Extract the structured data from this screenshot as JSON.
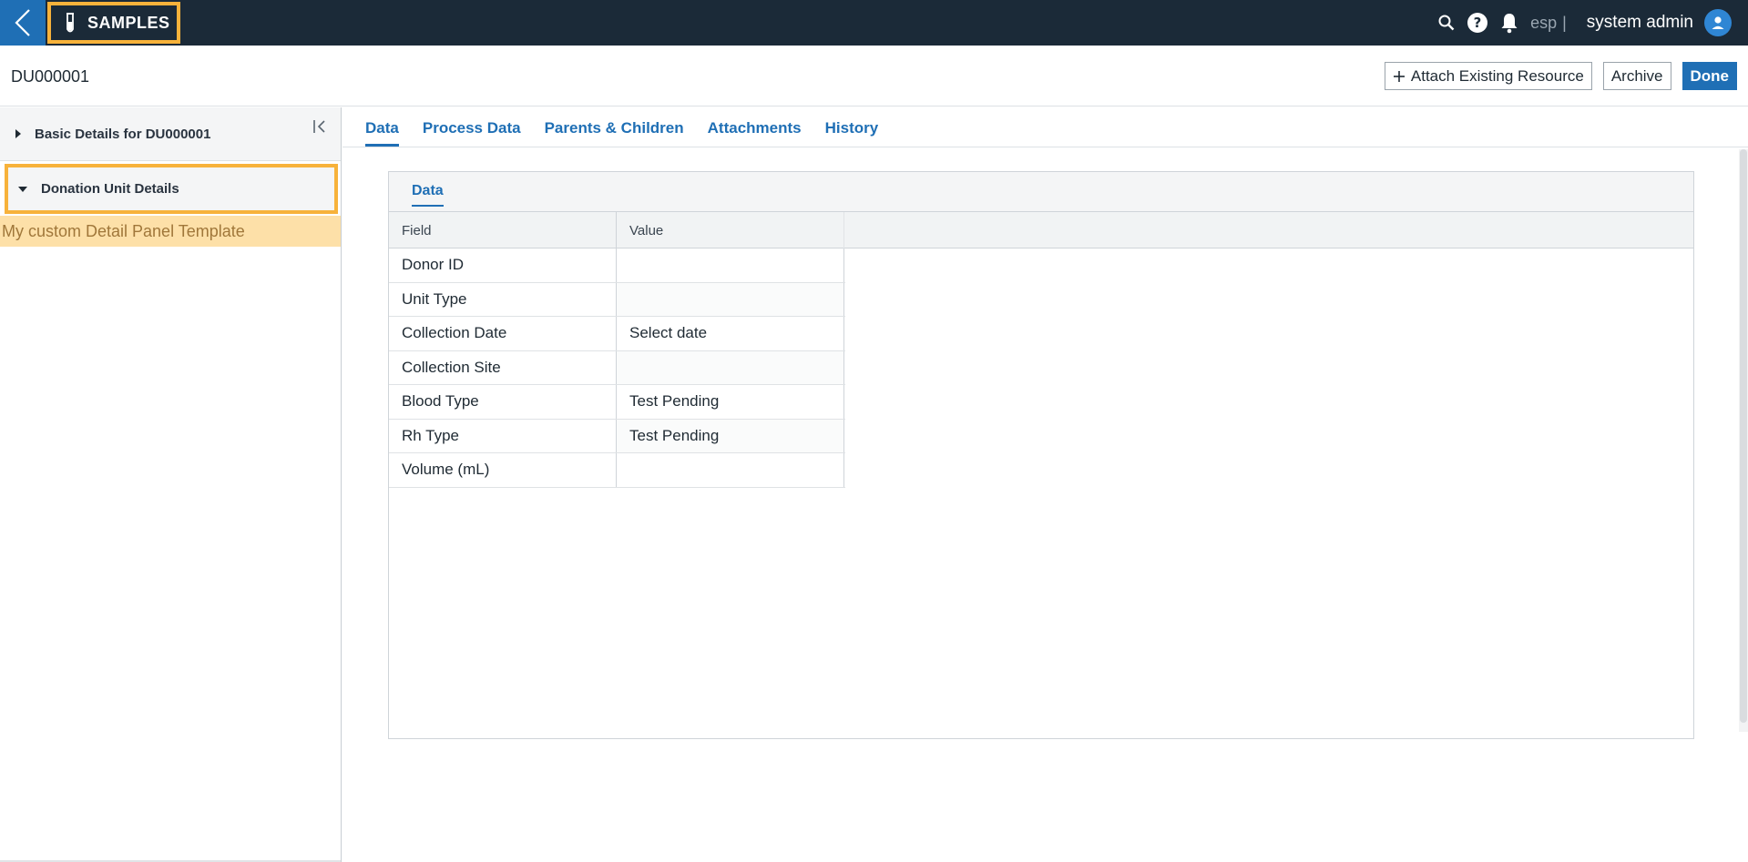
{
  "topbar": {
    "app_name": "SAMPLES",
    "language": "esp",
    "separator": "|",
    "user_name": "system admin"
  },
  "header": {
    "record_id": "DU000001",
    "attach_label": "Attach Existing Resource",
    "archive_label": "Archive",
    "done_label": "Done"
  },
  "left_panel": {
    "basic_details": "Basic Details for DU000001",
    "donation_details": "Donation Unit Details",
    "custom_template": "My custom Detail Panel Template"
  },
  "tabs": [
    "Data",
    "Process Data",
    "Parents & Children",
    "Attachments",
    "History"
  ],
  "inner_tab": "Data",
  "grid": {
    "headers": [
      "Field",
      "Value"
    ],
    "rows": [
      {
        "field": "Donor ID",
        "value": ""
      },
      {
        "field": "Unit Type",
        "value": ""
      },
      {
        "field": "Collection Date",
        "value": "Select date"
      },
      {
        "field": "Collection Site",
        "value": ""
      },
      {
        "field": "Blood Type",
        "value": "Test Pending"
      },
      {
        "field": "Rh Type",
        "value": "Test Pending"
      },
      {
        "field": "Volume (mL)",
        "value": ""
      }
    ]
  },
  "colors": {
    "topbar_bg": "#1b2a38",
    "accent": "#1f6fb5",
    "highlight": "#f7b23b",
    "template_bg": "#fde0a8"
  }
}
